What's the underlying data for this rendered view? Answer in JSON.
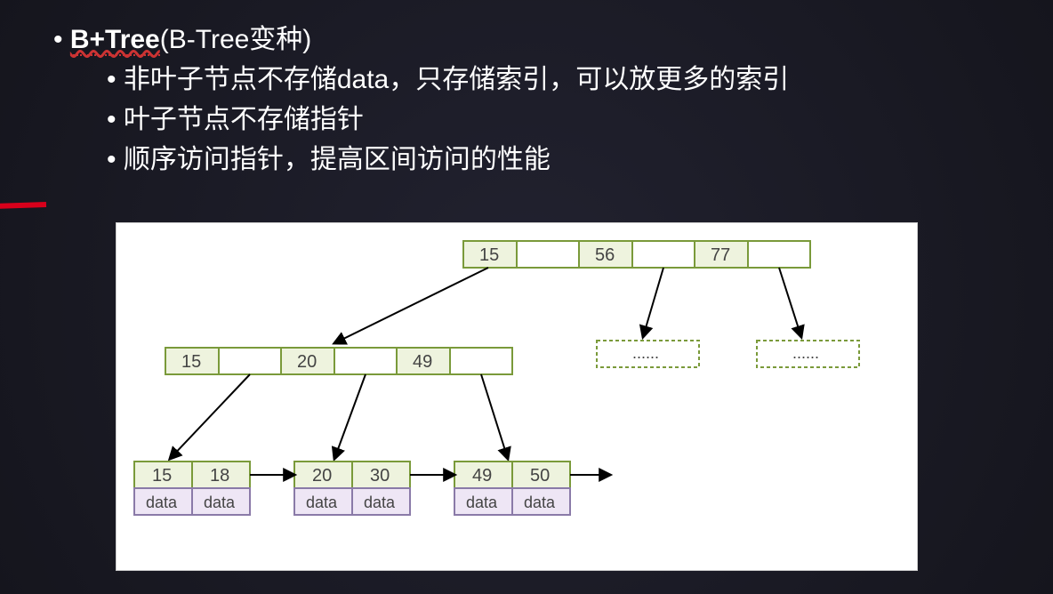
{
  "title_bold": "B+Tree",
  "title_rest": "(B-Tree变种)",
  "points": [
    "非叶子节点不存储data，只存储索引，可以放更多的索引",
    "叶子节点不存储指针",
    "顺序访问指针，提高区间访问的性能"
  ],
  "root_keys": [
    "15",
    "56",
    "77"
  ],
  "mid_keys": [
    "15",
    "20",
    "49"
  ],
  "leaves": [
    {
      "keys": [
        "15",
        "18"
      ],
      "data": [
        "data",
        "data"
      ]
    },
    {
      "keys": [
        "20",
        "30"
      ],
      "data": [
        "data",
        "data"
      ]
    },
    {
      "keys": [
        "49",
        "50"
      ],
      "data": [
        "data",
        "data"
      ]
    }
  ],
  "dashed_placeholder": "......"
}
